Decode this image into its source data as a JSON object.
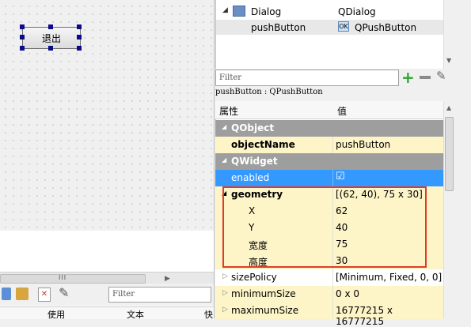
{
  "form": {
    "button_label": "退出"
  },
  "tree": {
    "rows": [
      {
        "name": "Dialog",
        "class": "QDialog"
      },
      {
        "name": "pushButton",
        "class": "QPushButton"
      }
    ]
  },
  "filter": {
    "placeholder": "Filter"
  },
  "object_label": "pushButton : QPushButton",
  "properties": {
    "header": {
      "col1": "属性",
      "col2": "值"
    },
    "rows": [
      {
        "name": "QObject",
        "value": ""
      },
      {
        "name": "objectName",
        "value": "pushButton"
      },
      {
        "name": "QWidget",
        "value": ""
      },
      {
        "name": "enabled",
        "value": "☑"
      },
      {
        "name": "geometry",
        "value": "[(62, 40), 75 x 30]"
      },
      {
        "name": "X",
        "value": "62"
      },
      {
        "name": "Y",
        "value": "40"
      },
      {
        "name": "宽度",
        "value": "75"
      },
      {
        "name": "高度",
        "value": "30"
      },
      {
        "name": "sizePolicy",
        "value": "[Minimum, Fixed, 0, 0]"
      },
      {
        "name": "minimumSize",
        "value": "0 x 0"
      },
      {
        "name": "maximumSize",
        "value": "16777215 x 16777215"
      }
    ]
  },
  "lower_left": {
    "scroll_grip": "III",
    "filter_placeholder": "Filter",
    "columns": [
      "使用",
      "文本",
      "快"
    ]
  },
  "colors": {
    "highlight_red": "#e23a2a",
    "selection_blue": "#3399ff",
    "category_gray": "#9e9e9e"
  }
}
